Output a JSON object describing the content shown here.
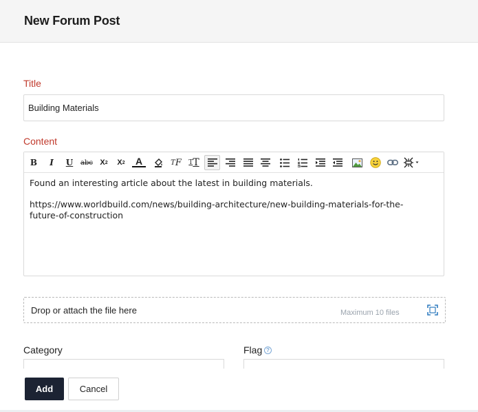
{
  "header": {
    "title": "New Forum Post"
  },
  "form": {
    "title_label": "Title",
    "title_value": "Building Materials",
    "content_label": "Content",
    "content_lines": [
      "Found an interesting article about the latest in building materials.",
      "https://www.worldbuild.com/news/building-architecture/new-building-materials-for-the-",
      "future-of-construction"
    ],
    "category_label": "Category",
    "flag_label": "Flag",
    "help_glyph": "?"
  },
  "toolbar": {
    "bold": "B",
    "italic": "I",
    "underline": "U",
    "strike": "abc",
    "subscript": "X",
    "subscript_mark": "2",
    "superscript": "X",
    "superscript_mark": "2",
    "font_color": "A",
    "font_family": "F",
    "font_size": "T",
    "icons": [
      "bold-icon",
      "italic-icon",
      "underline-icon",
      "strikethrough-icon",
      "subscript-icon",
      "superscript-icon",
      "font-color-icon",
      "background-color-icon",
      "font-family-icon",
      "font-size-icon",
      "align-left-icon",
      "align-right-icon",
      "justify-icon",
      "align-center-icon",
      "bulleted-list-icon",
      "numbered-list-icon",
      "indent-icon",
      "outdent-icon",
      "insert-image-icon",
      "emoji-icon",
      "link-icon",
      "more-options-icon"
    ]
  },
  "attachments": {
    "drop_label": "Drop or attach the file here",
    "max_files": "Maximum 10 files"
  },
  "actions": {
    "add_label": "Add",
    "cancel_label": "Cancel"
  },
  "colors": {
    "required": "#c0392b",
    "primary_button": "#1c2333",
    "accent": "#2f7bbf"
  }
}
